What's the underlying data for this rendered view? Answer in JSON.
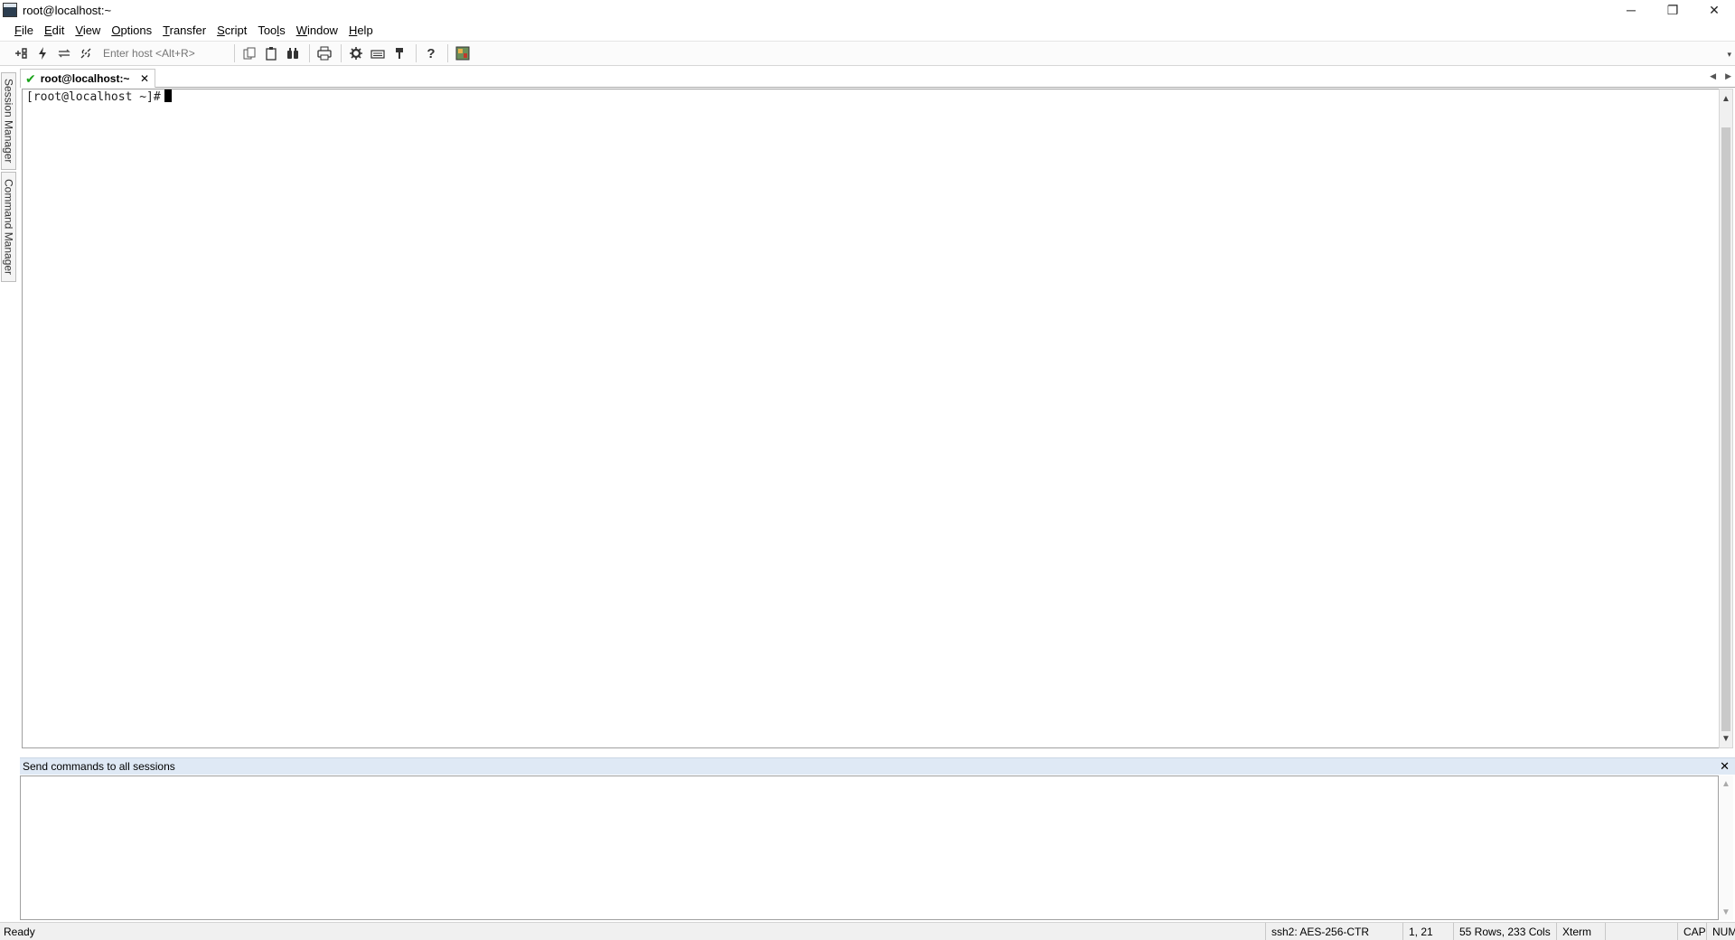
{
  "window": {
    "title": "root@localhost:~",
    "controls": {
      "minimize": "─",
      "restore": "❐",
      "close": "✕"
    }
  },
  "menu": [
    {
      "label": "File",
      "key": "F",
      "rest": "ile"
    },
    {
      "label": "Edit",
      "key": "E",
      "rest": "dit"
    },
    {
      "label": "View",
      "key": "V",
      "rest": "iew"
    },
    {
      "label": "Options",
      "key": "O",
      "rest": "ptions"
    },
    {
      "label": "Transfer",
      "key": "T",
      "rest": "ransfer"
    },
    {
      "label": "Script",
      "key": "S",
      "rest": "cript"
    },
    {
      "label": "Tools",
      "pre": "Too",
      "key": "l",
      "rest": "s"
    },
    {
      "label": "Window",
      "key": "W",
      "rest": "indow"
    },
    {
      "label": "Help",
      "key": "H",
      "rest": "elp"
    }
  ],
  "toolbar": {
    "host_placeholder": "Enter host <Alt+R>",
    "icons": [
      "connect-icon",
      "quick-connect-icon",
      "reconnect-icon",
      "disconnect-icon",
      "copy-icon",
      "paste-icon",
      "find-icon",
      "print-icon",
      "settings-icon",
      "keymap-icon",
      "sftp-icon",
      "help-icon",
      "securefx-icon"
    ]
  },
  "sidetabs": {
    "session_manager": "Session Manager",
    "command_manager": "Command Manager"
  },
  "session_tab": {
    "label": "root@localhost:~",
    "close": "✕"
  },
  "terminal": {
    "prompt": "[root@localhost ~]#"
  },
  "command_window": {
    "title": "Send commands to all sessions",
    "close": "✕"
  },
  "status": {
    "ready": "Ready",
    "cipher": "ssh2: AES-256-CTR",
    "position": "1,  21",
    "size": "55 Rows, 233 Cols",
    "term": "Xterm",
    "cap": "CAP",
    "num": "NUM"
  }
}
